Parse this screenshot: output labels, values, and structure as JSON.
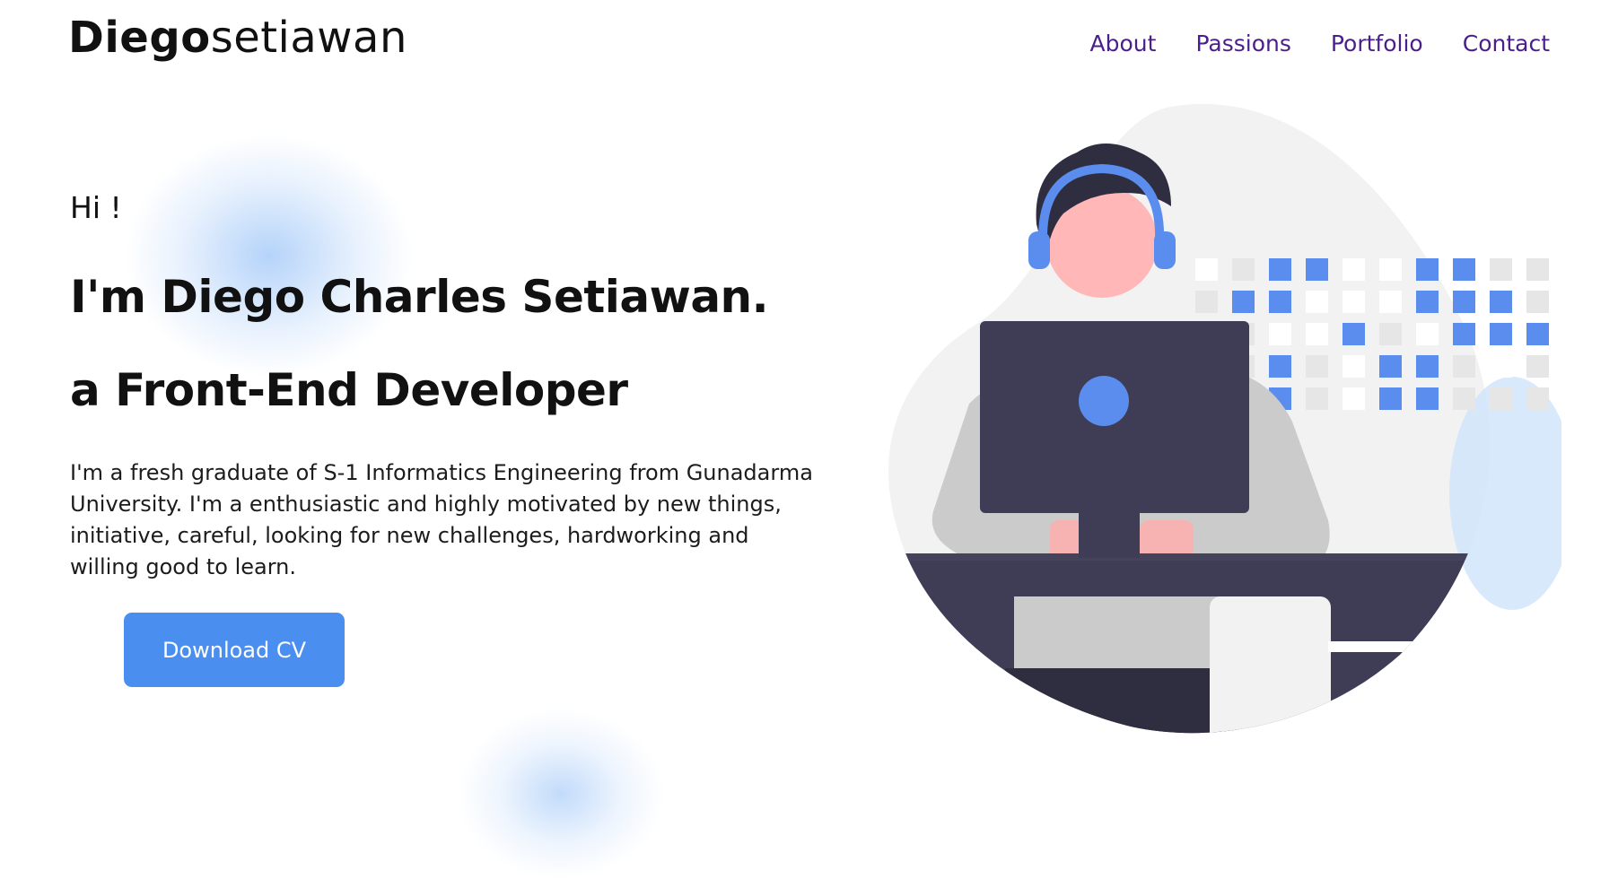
{
  "brand": {
    "bold": "Diego",
    "light": "setiawan"
  },
  "nav": {
    "items": [
      "About",
      "Passions",
      "Portfolio",
      "Contact"
    ]
  },
  "hero": {
    "greeting": "Hi !",
    "name_line": "I'm Diego Charles Setiawan.",
    "role_line": "a Front-End Developer",
    "description": "I'm a fresh graduate of S-1 Informatics Engineering from Gunadarma University. I'm a enthusiastic and highly motivated by new things, initiative, careful, looking for new challenges, hardworking and willing good to learn."
  },
  "cta": {
    "download_label": "Download CV"
  },
  "colors": {
    "accent": "#4a8ff0",
    "nav": "#4a1f8c",
    "illustration_dark": "#3f3d56",
    "pattern_blue": "#5b8def"
  }
}
